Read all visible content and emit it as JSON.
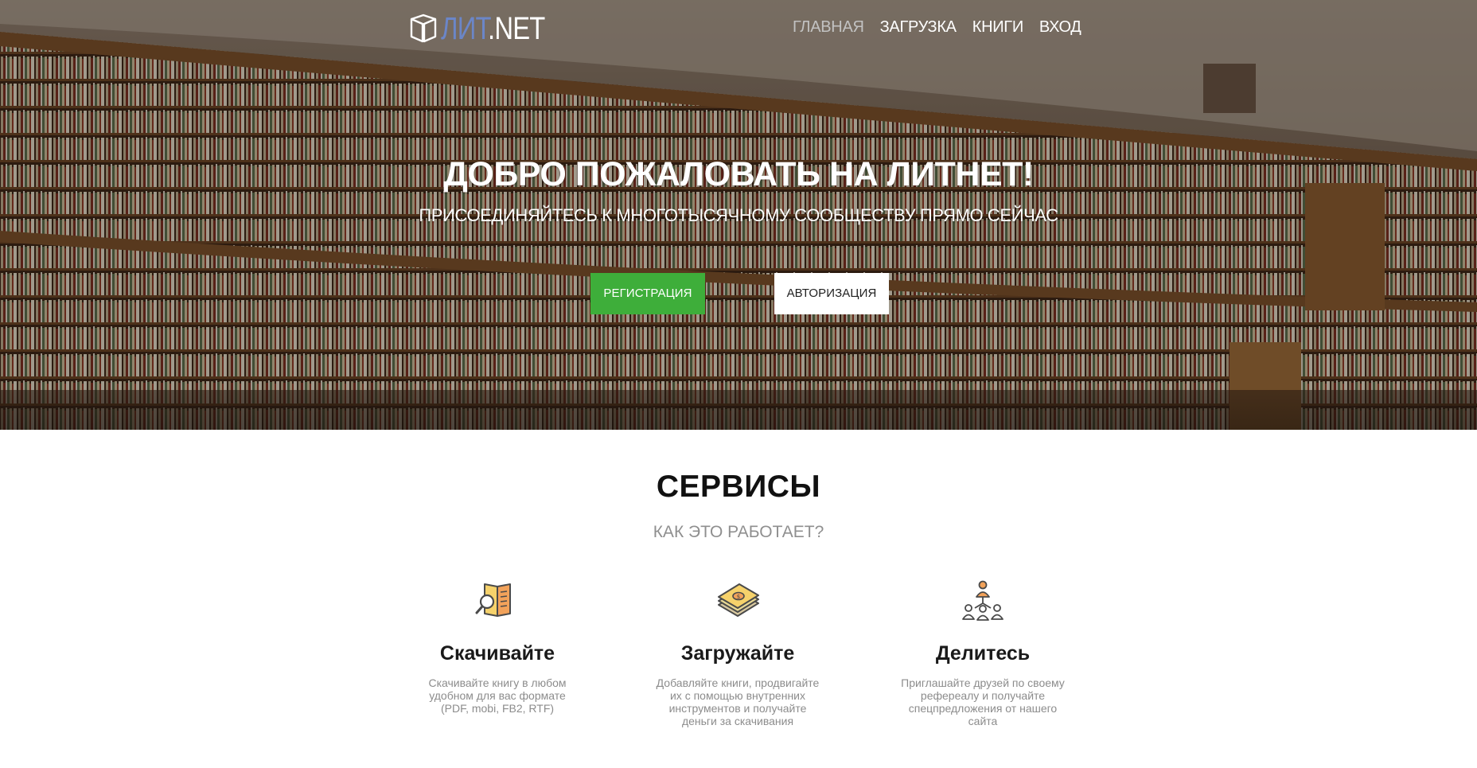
{
  "brand": {
    "logo_lit": "ЛИТ",
    "logo_net": ".NET",
    "accent_blue": "#6b86c8",
    "accent_green": "#3eae3a"
  },
  "nav": {
    "items": [
      {
        "label": "ГЛАВНАЯ",
        "active": true
      },
      {
        "label": "ЗАГРУЗКА",
        "active": false
      },
      {
        "label": "КНИГИ",
        "active": false
      },
      {
        "label": "ВХОД",
        "active": false
      }
    ]
  },
  "hero": {
    "title": "ДОБРО ПОЖАЛОВАТЬ НА ЛИТНЕТ!",
    "subtitle": "ПРИСОЕДИНЯЙТЕСЬ К МНОГОТЫСЯЧНОМУ СООБЩЕСТВУ ПРЯМО СЕЙЧАС",
    "register_label": "РЕГИСТРАЦИЯ",
    "login_label": "АВТОРИЗАЦИЯ"
  },
  "services": {
    "title": "СЕРВИСЫ",
    "subtitle": "КАК ЭТО РАБОТАЕТ?",
    "cards": [
      {
        "icon": "book-search-icon",
        "title": "Скачивайте",
        "text": "Скачивайте книгу в любом удобном для вас формате (PDF, mobi, FB2, RTF)"
      },
      {
        "icon": "money-stack-icon",
        "title": "Загружайте",
        "text": "Добавляйте книги, продвигайте их с помощью внутренних инструментов и получайте деньги за скачивания"
      },
      {
        "icon": "referral-network-icon",
        "title": "Делитесь",
        "text": "Приглашайте друзей по своему рефереалу и получайте спецпредложения от нашего сайта"
      }
    ]
  }
}
